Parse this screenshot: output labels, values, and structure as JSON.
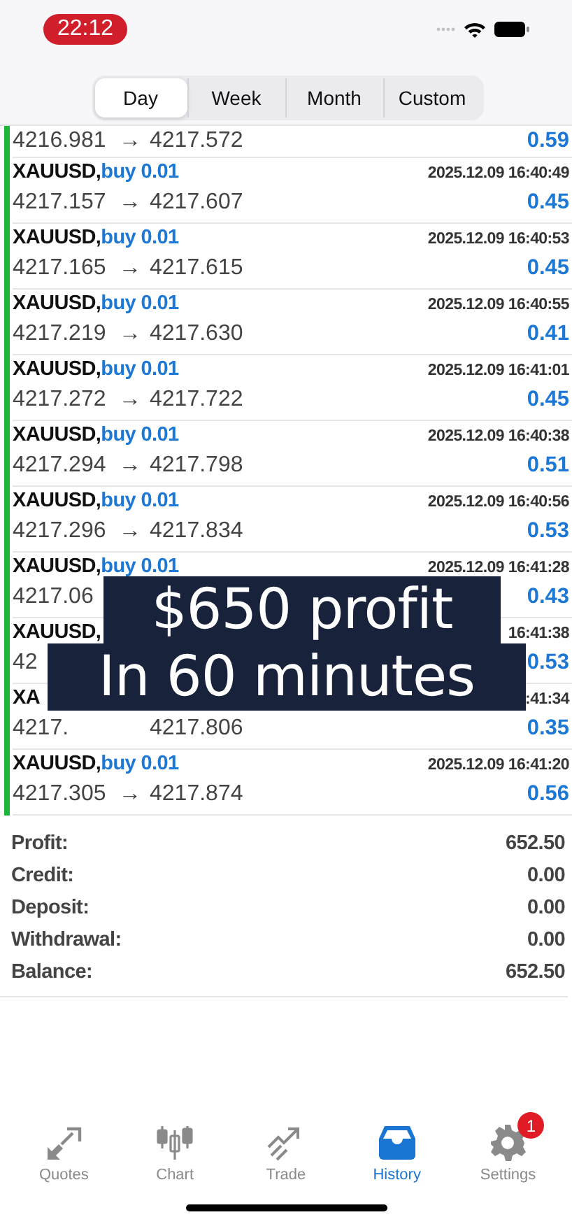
{
  "status_bar": {
    "time": "22:12"
  },
  "periods": [
    {
      "label": "Day",
      "selected": true
    },
    {
      "label": "Week",
      "selected": false
    },
    {
      "label": "Month",
      "selected": false
    },
    {
      "label": "Custom",
      "selected": false
    }
  ],
  "trades": [
    {
      "open": "4216.981",
      "arrow": "→",
      "close": "4217.572",
      "profit": "0.59",
      "kind": "cut"
    },
    {
      "symbol": "XAUUSD,",
      "side": "buy 0.01",
      "time": "2025.12.09 16:40:49",
      "open": "4217.157",
      "arrow": "→",
      "close": "4217.607",
      "profit": "0.45",
      "kind": "full"
    },
    {
      "symbol": "XAUUSD,",
      "side": "buy 0.01",
      "time": "2025.12.09 16:40:53",
      "open": "4217.165",
      "arrow": "→",
      "close": "4217.615",
      "profit": "0.45",
      "kind": "full"
    },
    {
      "symbol": "XAUUSD,",
      "side": "buy 0.01",
      "time": "2025.12.09 16:40:55",
      "open": "4217.219",
      "arrow": "→",
      "close": "4217.630",
      "profit": "0.41",
      "kind": "full"
    },
    {
      "symbol": "XAUUSD,",
      "side": "buy 0.01",
      "time": "2025.12.09 16:41:01",
      "open": "4217.272",
      "arrow": "→",
      "close": "4217.722",
      "profit": "0.45",
      "kind": "full"
    },
    {
      "symbol": "XAUUSD,",
      "side": "buy 0.01",
      "time": "2025.12.09 16:40:38",
      "open": "4217.294",
      "arrow": "→",
      "close": "4217.798",
      "profit": "0.51",
      "kind": "full"
    },
    {
      "symbol": "XAUUSD,",
      "side": "buy 0.01",
      "time": "2025.12.09 16:40:56",
      "open": "4217.296",
      "arrow": "→",
      "close": "4217.834",
      "profit": "0.53",
      "kind": "full"
    },
    {
      "symbol": "XAUUSD,",
      "side": "buy 0.01",
      "time": "2025.12.09 16:41:28",
      "open": "4217.06",
      "profit": "0.43",
      "kind": "full"
    },
    {
      "symbol": "XAUUSD,",
      "time": "16:41:38",
      "open": "42",
      "profit": "0.53",
      "kind": "full"
    },
    {
      "symbol": "XA",
      "time": ":41:34",
      "open": "4217.",
      "close": "4217.806",
      "profit": "0.35",
      "kind": "full"
    },
    {
      "symbol": "XAUUSD,",
      "side": "buy 0.01",
      "time": "2025.12.09 16:41:20",
      "open": "4217.305",
      "arrow": "→",
      "close": "4217.874",
      "profit": "0.56",
      "kind": "full"
    }
  ],
  "caption": [
    "$650 profit",
    "In 60 minutes"
  ],
  "summary": [
    {
      "label": "Profit:",
      "value": "652.50"
    },
    {
      "label": "Credit:",
      "value": "0.00"
    },
    {
      "label": "Deposit:",
      "value": "0.00"
    },
    {
      "label": "Withdrawal:",
      "value": "0.00"
    },
    {
      "label": "Balance:",
      "value": "652.50"
    }
  ],
  "tab_bar": [
    {
      "label": "Quotes",
      "kind": "quotes",
      "selected": false
    },
    {
      "label": "Chart",
      "kind": "chart",
      "selected": false
    },
    {
      "label": "Trade",
      "kind": "trade",
      "selected": false
    },
    {
      "label": "History",
      "kind": "history",
      "selected": true
    },
    {
      "label": "Settings",
      "kind": "settings",
      "selected": false,
      "badge": "1"
    }
  ]
}
